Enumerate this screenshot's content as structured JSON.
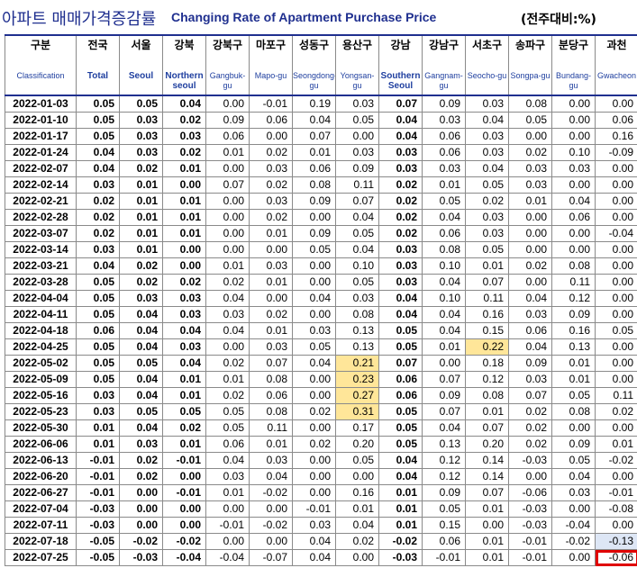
{
  "title": {
    "korean": "아파트 매매가격증감률",
    "english": "Changing Rate of Apartment Purchase Price",
    "unit": "(전주대비:%)"
  },
  "columns": [
    {
      "kr": "구분",
      "en": "Classification",
      "en_bold": false
    },
    {
      "kr": "전국",
      "en": "Total",
      "en_bold": true
    },
    {
      "kr": "서울",
      "en": "Seoul",
      "en_bold": true
    },
    {
      "kr": "강북",
      "en": "Northern seoul",
      "en_bold": true
    },
    {
      "kr": "강북구",
      "en": "Gangbuk-gu",
      "en_bold": false
    },
    {
      "kr": "마포구",
      "en": "Mapo-gu",
      "en_bold": false
    },
    {
      "kr": "성동구",
      "en": "Seongdong-gu",
      "en_bold": false
    },
    {
      "kr": "용산구",
      "en": "Yongsan-gu",
      "en_bold": false
    },
    {
      "kr": "강남",
      "en": "Southern Seoul",
      "en_bold": true
    },
    {
      "kr": "강남구",
      "en": "Gangnam-gu",
      "en_bold": false
    },
    {
      "kr": "서초구",
      "en": "Seocho-gu",
      "en_bold": false
    },
    {
      "kr": "송파구",
      "en": "Songpa-gu",
      "en_bold": false
    },
    {
      "kr": "분당구",
      "en": "Bundang-gu",
      "en_bold": false
    },
    {
      "kr": "과천",
      "en": "Gwacheon",
      "en_bold": false
    }
  ],
  "rows": [
    {
      "date": "2022-01-03",
      "values": [
        "0.05",
        "0.05",
        "0.04",
        "0.00",
        "-0.01",
        "0.19",
        "0.03",
        "0.07",
        "0.09",
        "0.03",
        "0.08",
        "0.00",
        "0.00"
      ]
    },
    {
      "date": "2022-01-10",
      "values": [
        "0.05",
        "0.03",
        "0.02",
        "0.09",
        "0.06",
        "0.04",
        "0.05",
        "0.04",
        "0.03",
        "0.04",
        "0.05",
        "0.00",
        "0.06"
      ]
    },
    {
      "date": "2022-01-17",
      "values": [
        "0.05",
        "0.03",
        "0.03",
        "0.06",
        "0.00",
        "0.07",
        "0.00",
        "0.04",
        "0.06",
        "0.03",
        "0.00",
        "0.00",
        "0.16"
      ]
    },
    {
      "date": "2022-01-24",
      "values": [
        "0.04",
        "0.03",
        "0.02",
        "0.01",
        "0.02",
        "0.01",
        "0.03",
        "0.03",
        "0.06",
        "0.03",
        "0.02",
        "0.10",
        "-0.09"
      ]
    },
    {
      "date": "2022-02-07",
      "values": [
        "0.04",
        "0.02",
        "0.01",
        "0.00",
        "0.03",
        "0.06",
        "0.09",
        "0.03",
        "0.03",
        "0.04",
        "0.03",
        "0.03",
        "0.00"
      ]
    },
    {
      "date": "2022-02-14",
      "values": [
        "0.03",
        "0.01",
        "0.00",
        "0.07",
        "0.02",
        "0.08",
        "0.11",
        "0.02",
        "0.01",
        "0.05",
        "0.03",
        "0.00",
        "0.00"
      ]
    },
    {
      "date": "2022-02-21",
      "values": [
        "0.02",
        "0.01",
        "0.01",
        "0.00",
        "0.03",
        "0.09",
        "0.07",
        "0.02",
        "0.05",
        "0.02",
        "0.01",
        "0.04",
        "0.00"
      ]
    },
    {
      "date": "2022-02-28",
      "values": [
        "0.02",
        "0.01",
        "0.01",
        "0.00",
        "0.02",
        "0.00",
        "0.04",
        "0.02",
        "0.04",
        "0.03",
        "0.00",
        "0.06",
        "0.00"
      ]
    },
    {
      "date": "2022-03-07",
      "values": [
        "0.02",
        "0.01",
        "0.01",
        "0.00",
        "0.01",
        "0.09",
        "0.05",
        "0.02",
        "0.06",
        "0.03",
        "0.00",
        "0.00",
        "-0.04"
      ]
    },
    {
      "date": "2022-03-14",
      "values": [
        "0.03",
        "0.01",
        "0.00",
        "0.00",
        "0.00",
        "0.05",
        "0.04",
        "0.03",
        "0.08",
        "0.05",
        "0.00",
        "0.00",
        "0.00"
      ]
    },
    {
      "date": "2022-03-21",
      "values": [
        "0.04",
        "0.02",
        "0.00",
        "0.01",
        "0.03",
        "0.00",
        "0.10",
        "0.03",
        "0.10",
        "0.01",
        "0.02",
        "0.08",
        "0.00"
      ]
    },
    {
      "date": "2022-03-28",
      "values": [
        "0.05",
        "0.02",
        "0.02",
        "0.02",
        "0.01",
        "0.00",
        "0.05",
        "0.03",
        "0.04",
        "0.07",
        "0.00",
        "0.11",
        "0.00"
      ]
    },
    {
      "date": "2022-04-04",
      "values": [
        "0.05",
        "0.03",
        "0.03",
        "0.04",
        "0.00",
        "0.04",
        "0.03",
        "0.04",
        "0.10",
        "0.11",
        "0.04",
        "0.12",
        "0.00"
      ]
    },
    {
      "date": "2022-04-11",
      "values": [
        "0.05",
        "0.04",
        "0.03",
        "0.03",
        "0.02",
        "0.00",
        "0.08",
        "0.04",
        "0.04",
        "0.16",
        "0.03",
        "0.09",
        "0.00"
      ]
    },
    {
      "date": "2022-04-18",
      "values": [
        "0.06",
        "0.04",
        "0.04",
        "0.04",
        "0.01",
        "0.03",
        "0.13",
        "0.05",
        "0.04",
        "0.15",
        "0.06",
        "0.16",
        "0.05"
      ]
    },
    {
      "date": "2022-04-25",
      "values": [
        "0.05",
        "0.04",
        "0.03",
        "0.00",
        "0.03",
        "0.05",
        "0.13",
        "0.05",
        "0.01",
        "0.22",
        "0.04",
        "0.13",
        "0.00"
      ]
    },
    {
      "date": "2022-05-02",
      "values": [
        "0.05",
        "0.05",
        "0.04",
        "0.02",
        "0.07",
        "0.04",
        "0.21",
        "0.07",
        "0.00",
        "0.18",
        "0.09",
        "0.01",
        "0.00"
      ]
    },
    {
      "date": "2022-05-09",
      "values": [
        "0.05",
        "0.04",
        "0.01",
        "0.01",
        "0.08",
        "0.00",
        "0.23",
        "0.06",
        "0.07",
        "0.12",
        "0.03",
        "0.01",
        "0.00"
      ]
    },
    {
      "date": "2022-05-16",
      "values": [
        "0.03",
        "0.04",
        "0.01",
        "0.02",
        "0.06",
        "0.00",
        "0.27",
        "0.06",
        "0.09",
        "0.08",
        "0.07",
        "0.05",
        "0.11"
      ]
    },
    {
      "date": "2022-05-23",
      "values": [
        "0.03",
        "0.05",
        "0.05",
        "0.05",
        "0.08",
        "0.02",
        "0.31",
        "0.05",
        "0.07",
        "0.01",
        "0.02",
        "0.08",
        "0.02"
      ]
    },
    {
      "date": "2022-05-30",
      "values": [
        "0.01",
        "0.04",
        "0.02",
        "0.05",
        "0.11",
        "0.00",
        "0.17",
        "0.05",
        "0.04",
        "0.07",
        "0.02",
        "0.00",
        "0.00"
      ]
    },
    {
      "date": "2022-06-06",
      "values": [
        "0.01",
        "0.03",
        "0.01",
        "0.06",
        "0.01",
        "0.02",
        "0.20",
        "0.05",
        "0.13",
        "0.20",
        "0.02",
        "0.09",
        "0.01"
      ]
    },
    {
      "date": "2022-06-13",
      "values": [
        "-0.01",
        "0.02",
        "-0.01",
        "0.04",
        "0.03",
        "0.00",
        "0.05",
        "0.04",
        "0.12",
        "0.14",
        "-0.03",
        "0.05",
        "-0.02"
      ]
    },
    {
      "date": "2022-06-20",
      "values": [
        "-0.01",
        "0.02",
        "0.00",
        "0.03",
        "0.04",
        "0.00",
        "0.00",
        "0.04",
        "0.12",
        "0.14",
        "0.00",
        "0.04",
        "0.00"
      ]
    },
    {
      "date": "2022-06-27",
      "values": [
        "-0.01",
        "0.00",
        "-0.01",
        "0.01",
        "-0.02",
        "0.00",
        "0.16",
        "0.01",
        "0.09",
        "0.07",
        "-0.06",
        "0.03",
        "-0.01"
      ]
    },
    {
      "date": "2022-07-04",
      "values": [
        "-0.03",
        "0.00",
        "0.00",
        "0.00",
        "0.00",
        "-0.01",
        "0.01",
        "0.01",
        "0.05",
        "0.01",
        "-0.03",
        "0.00",
        "-0.08"
      ]
    },
    {
      "date": "2022-07-11",
      "values": [
        "-0.03",
        "0.00",
        "0.00",
        "-0.01",
        "-0.02",
        "0.03",
        "0.04",
        "0.01",
        "0.15",
        "0.00",
        "-0.03",
        "-0.04",
        "0.00"
      ]
    },
    {
      "date": "2022-07-18",
      "values": [
        "-0.05",
        "-0.02",
        "-0.02",
        "0.00",
        "0.00",
        "0.04",
        "0.02",
        "-0.02",
        "0.06",
        "0.01",
        "-0.01",
        "-0.02",
        "-0.13"
      ]
    },
    {
      "date": "2022-07-25",
      "values": [
        "-0.05",
        "-0.03",
        "-0.04",
        "-0.04",
        "-0.07",
        "0.04",
        "0.00",
        "-0.03",
        "-0.01",
        "0.01",
        "-0.01",
        "0.00",
        "-0.06"
      ]
    }
  ],
  "highlights": {
    "yellow": [
      [
        15,
        9
      ],
      [
        16,
        6
      ],
      [
        17,
        6
      ],
      [
        18,
        6
      ],
      [
        19,
        6
      ]
    ],
    "blue": [
      [
        27,
        12
      ]
    ],
    "red_box": [
      [
        28,
        12
      ]
    ]
  },
  "colors": {
    "title": "#1f2f8f",
    "header_en": "#1f3f9f",
    "highlight_yellow": "#ffe699",
    "highlight_blue": "#dde6f5",
    "highlight_red_border": "#e00000"
  }
}
